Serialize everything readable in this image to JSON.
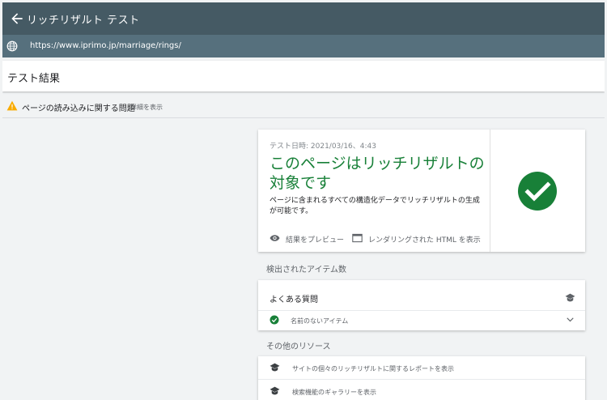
{
  "header": {
    "title": "リッチリザルト テスト"
  },
  "url_bar": {
    "url": "https://www.iprimo.jp/marriage/rings/"
  },
  "results": {
    "title": "テスト結果"
  },
  "issue": {
    "label": "ページの読み込みに関する問題",
    "detail_link": "詳細を表示"
  },
  "summary": {
    "test_date": "テスト日時: 2021/03/16、4:43",
    "headline": "このページはリッチリザルトの対象です",
    "description": "ページに含まれるすべての構造化データでリッチリザルトの生成が可能です。",
    "preview_label": "結果をプレビュー",
    "rendered_html_label": "レンダリングされた HTML を表示",
    "status_color": "#188038"
  },
  "detected": {
    "section_label": "検出されたアイテム数",
    "type_label": "よくある質問",
    "item_label": "名前のないアイテム"
  },
  "resources": {
    "section_label": "その他のリソース",
    "items": [
      "サイトの個々のリッチリザルトに関するレポートを表示",
      "検索機能のギャラリーを表示"
    ]
  },
  "colors": {
    "header": "#455a64",
    "url_bar": "#56707d",
    "success": "#188038",
    "warning": "#f9ab00"
  }
}
